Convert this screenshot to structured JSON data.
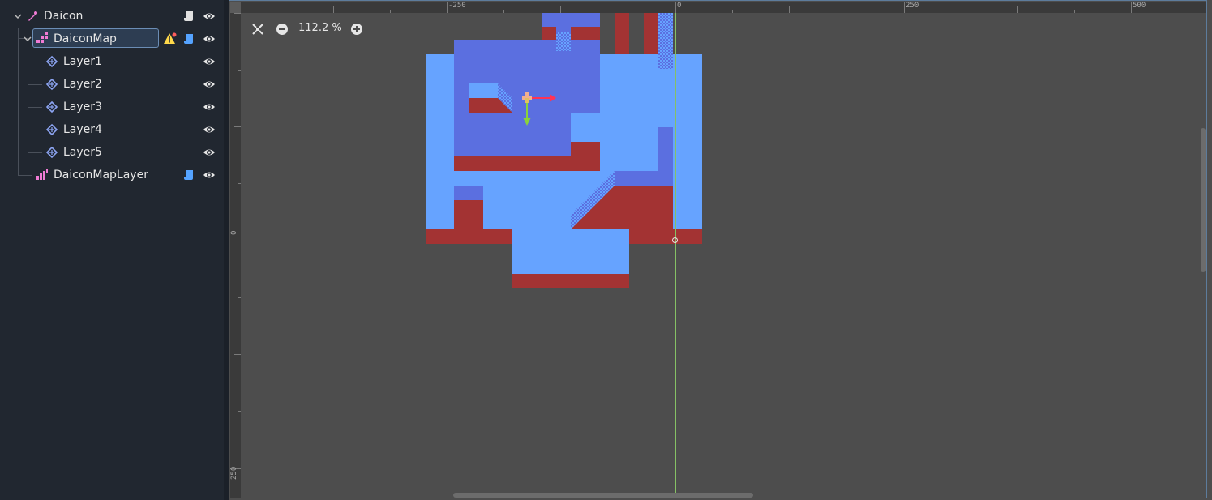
{
  "scene_tree": {
    "nodes": [
      {
        "name": "Daicon",
        "icon": "node2d-bone-icon",
        "has_script": true,
        "visible": true,
        "expanded": true
      },
      {
        "name": "DaiconMap",
        "icon": "tilemap-icon",
        "has_script": true,
        "has_warning": true,
        "visible": true,
        "selected": true,
        "expanded": true
      },
      {
        "name": "Layer1",
        "icon": "tilemap-layer-icon",
        "visible": true
      },
      {
        "name": "Layer2",
        "icon": "tilemap-layer-icon",
        "visible": true
      },
      {
        "name": "Layer3",
        "icon": "tilemap-layer-icon",
        "visible": true
      },
      {
        "name": "Layer4",
        "icon": "tilemap-layer-icon",
        "visible": true
      },
      {
        "name": "Layer5",
        "icon": "tilemap-layer-icon",
        "visible": true
      },
      {
        "name": "DaiconMapLayer",
        "icon": "tilemap-layer-icon",
        "has_script": true,
        "visible": true
      }
    ]
  },
  "viewport": {
    "zoom_label": "112.2 %",
    "controls": [
      "center-view-icon",
      "zoom-out-icon",
      "zoom-in-icon"
    ],
    "ruler_h_labels": [
      "-250",
      "0",
      "250",
      "500"
    ],
    "ruler_v_labels": [
      "0",
      "250"
    ],
    "colors": {
      "background": "#4d4d4d",
      "tile_light": "#66a3ff",
      "tile_dark": "#5b6fe0",
      "tile_red": "#a33333",
      "x_axis": "#c8466c",
      "y_axis": "#86c165",
      "selection": "#6b8db5"
    }
  }
}
